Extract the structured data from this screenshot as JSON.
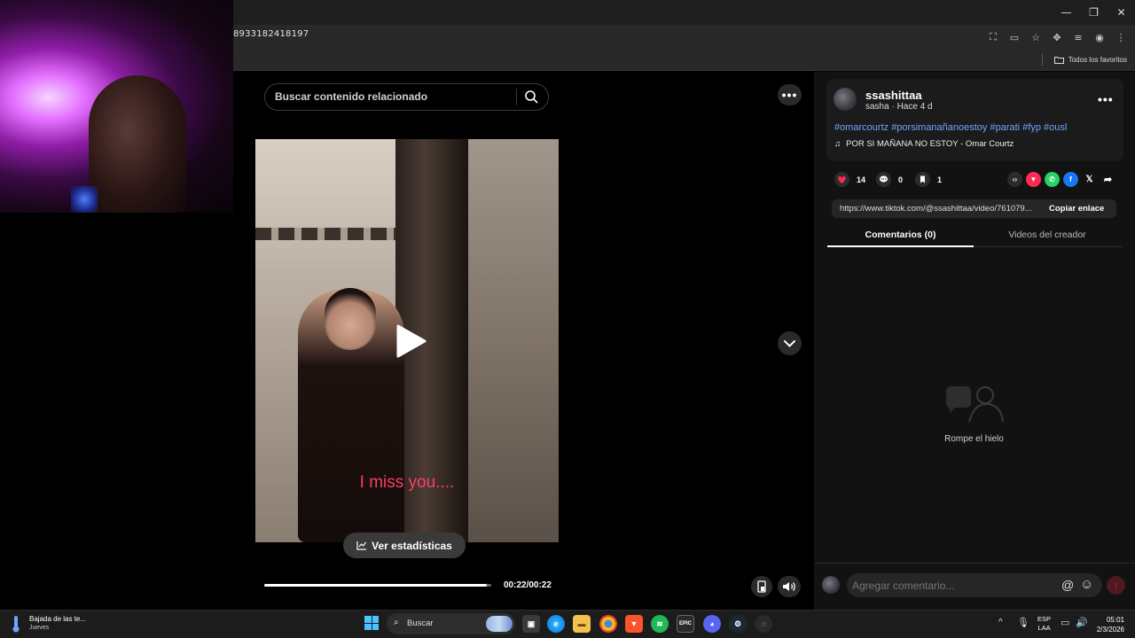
{
  "browser": {
    "url_visible": "8933182418197",
    "bookmarks_all_label": "Todos los favoritos",
    "window_controls": [
      "—",
      "❐",
      "✕"
    ]
  },
  "search": {
    "placeholder": "Buscar contenido relacionado"
  },
  "video": {
    "caption": "I miss you....",
    "stats_button_label": "Ver estadísticas",
    "time_label": "00:22/00:22",
    "progress_fraction": 0.98
  },
  "post": {
    "username": "ssashittaa",
    "subtitle": "sasha · Hace 4 d",
    "hashtags": "#omarcourtz #porsimanañanoestoy #parati #fyp #ousl",
    "music": "POR SI MAÑANA NO ESTOY - Omar Courtz",
    "likes": "14",
    "comments": "0",
    "saves": "1",
    "link": "https://www.tiktok.com/@ssashittaa/video/761079...",
    "copy_link_label": "Copiar enlace"
  },
  "tabs": [
    {
      "label": "Comentarios (0)",
      "active": true
    },
    {
      "label": "Videos del creador",
      "active": false
    }
  ],
  "comments_empty_text": "Rompe el hielo",
  "comment_input": {
    "placeholder": "Agregar comentario..."
  },
  "taskbar": {
    "weather_title": "Bajada de las te...",
    "weather_sub": "Jueves",
    "search_label": "Buscar",
    "lang_line1": "ESP",
    "lang_line2": "LAA",
    "time": "05:01",
    "date": "2/3/2026",
    "epic_label": "EPIC"
  },
  "colors": {
    "accent_link": "#72a2ff",
    "caption": "#ff3c66",
    "like_heart": "#fe2c55"
  }
}
